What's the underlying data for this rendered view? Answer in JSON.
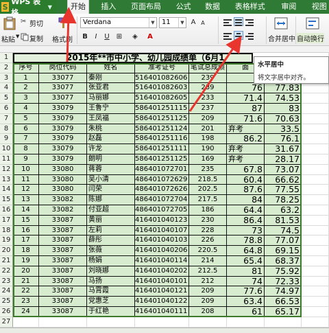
{
  "tabs": {
    "app": "WPS 表格",
    "items": [
      "开始",
      "插入",
      "页面布局",
      "公式",
      "数据",
      "表格样式",
      "审阅",
      "视图"
    ]
  },
  "ribbon": {
    "paste": "粘贴",
    "cut": "剪切",
    "copy": "复制",
    "format_painter": "格式刷",
    "font_name": "Verdana",
    "font_size": "11",
    "merge_center": "合并居中",
    "wrap_text": "自动换行"
  },
  "tooltip": {
    "title": "水平居中",
    "desc": "将文字居中对齐。"
  },
  "sheet": {
    "title": "2015年**市中小学、幼儿园成绩单（6月1",
    "headers": [
      "序号",
      "岗位代码",
      "姓名",
      "准考证号",
      "笔试总成绩",
      "面"
    ],
    "row_numbers": [
      "1",
      "2",
      "3",
      "4",
      "5",
      "6",
      "7",
      "8",
      "9",
      "10",
      "11",
      "12",
      "13",
      "14",
      "15",
      "16",
      "17",
      "18",
      "19",
      "20",
      "21",
      "22",
      "23",
      "24",
      "25",
      "26",
      "27"
    ],
    "rows": [
      {
        "no": "1",
        "code": "33077",
        "name": "秦刚",
        "ticket": "516401082606",
        "score": "239",
        "g": "",
        "h": ""
      },
      {
        "no": "2",
        "code": "33077",
        "name": "张亚君",
        "ticket": "516401082603",
        "score": "239",
        "g": "76",
        "h": "77.83"
      },
      {
        "no": "3",
        "code": "33077",
        "name": "马丽娜",
        "ticket": "516401082605",
        "score": "233",
        "g": "71.4",
        "h": "74.53"
      },
      {
        "no": "4",
        "code": "33079",
        "name": "王鲁宁",
        "ticket": "586401251115",
        "score": "237",
        "g": "87",
        "h": "83"
      },
      {
        "no": "5",
        "code": "33079",
        "name": "王凤福",
        "ticket": "586401251125",
        "score": "209",
        "g": "71.6",
        "h": "70.63"
      },
      {
        "no": "6",
        "code": "33079",
        "name": "朱桃",
        "ticket": "586401251124",
        "score": "201",
        "g": "弃考",
        "h": "33.5"
      },
      {
        "no": "7",
        "code": "33079",
        "name": "赵磊",
        "ticket": "586401251116",
        "score": "198",
        "g": "86.2",
        "h": "76.1"
      },
      {
        "no": "8",
        "code": "33079",
        "name": "许龙",
        "ticket": "586401251111",
        "score": "190",
        "g": "弃考",
        "h": "31.67"
      },
      {
        "no": "9",
        "code": "33079",
        "name": "朗明",
        "ticket": "586401251125",
        "score": "169",
        "g": "弃考",
        "h": "28.17"
      },
      {
        "no": "10",
        "code": "33080",
        "name": "蒋蓉",
        "ticket": "486401072701",
        "score": "235",
        "g": "67.8",
        "h": "73.07"
      },
      {
        "no": "11",
        "code": "33080",
        "name": "吴小清",
        "ticket": "486401072629",
        "score": "218.5",
        "g": "60.4",
        "h": "66.62"
      },
      {
        "no": "12",
        "code": "33080",
        "name": "闫荣",
        "ticket": "486401072626",
        "score": "202.5",
        "g": "87.6",
        "h": "77.55"
      },
      {
        "no": "13",
        "code": "33082",
        "name": "陈娜",
        "ticket": "486401072704",
        "score": "217.5",
        "g": "84",
        "h": "78.25"
      },
      {
        "no": "14",
        "code": "33082",
        "name": "付亚超",
        "ticket": "486401072705",
        "score": "186",
        "g": "64.4",
        "h": "63.2"
      },
      {
        "no": "15",
        "code": "33087",
        "name": "黄丽",
        "ticket": "416401040123",
        "score": "230",
        "g": "86.4",
        "h": "81.53"
      },
      {
        "no": "16",
        "code": "33087",
        "name": "左莉",
        "ticket": "416401040107",
        "score": "228",
        "g": "73",
        "h": "74.5"
      },
      {
        "no": "17",
        "code": "33087",
        "name": "薛彤",
        "ticket": "416401040103",
        "score": "226",
        "g": "78.8",
        "h": "77.07"
      },
      {
        "no": "18",
        "code": "33087",
        "name": "张薇",
        "ticket": "416401040206",
        "score": "220.5",
        "g": "64.8",
        "h": "69.15"
      },
      {
        "no": "19",
        "code": "33087",
        "name": "杨娟",
        "ticket": "416401040114",
        "score": "214",
        "g": "65.4",
        "h": "68.37"
      },
      {
        "no": "20",
        "code": "33087",
        "name": "刘晓娜",
        "ticket": "416401040202",
        "score": "212.5",
        "g": "81",
        "h": "75.92"
      },
      {
        "no": "21",
        "code": "33087",
        "name": "马扬",
        "ticket": "416401040101",
        "score": "212",
        "g": "74",
        "h": "72.33"
      },
      {
        "no": "22",
        "code": "33087",
        "name": "马霄霞",
        "ticket": "416401040121",
        "score": "209",
        "g": "77.6",
        "h": "74.97"
      },
      {
        "no": "23",
        "code": "33087",
        "name": "党惠芝",
        "ticket": "416401040122",
        "score": "209",
        "g": "63.4",
        "h": "66.53"
      },
      {
        "no": "24",
        "code": "33087",
        "name": "于红艳",
        "ticket": "416401040111",
        "score": "208",
        "g": "61",
        "h": "65.17"
      }
    ]
  },
  "colors": {
    "tab_bar": "#2f7a34",
    "cell_green": "#d7ebcf",
    "arrow_red": "#e8352e"
  }
}
